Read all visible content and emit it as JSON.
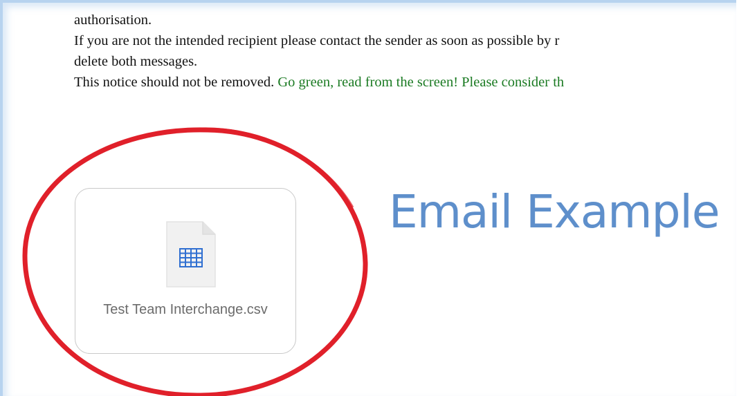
{
  "email": {
    "disclaimer": {
      "line1": "authorisation.",
      "line2": "If you are not the intended recipient please contact the sender as soon as possible by r",
      "line3": "delete both messages.",
      "line4_black": "This notice should not be removed. ",
      "line4_green": "Go green, read from the screen! Please consider th"
    },
    "attachment": {
      "file_name": "Test Team Interchange.csv",
      "icon": "spreadsheet-file-icon"
    }
  },
  "annotation": {
    "caption": "Email Example",
    "highlight_color": "#e0202a",
    "caption_color": "#5e8fcb"
  },
  "colors": {
    "green_text": "#1a7a22",
    "frame_border": "#b7d3ef",
    "grid_blue": "#2f6fd1"
  }
}
